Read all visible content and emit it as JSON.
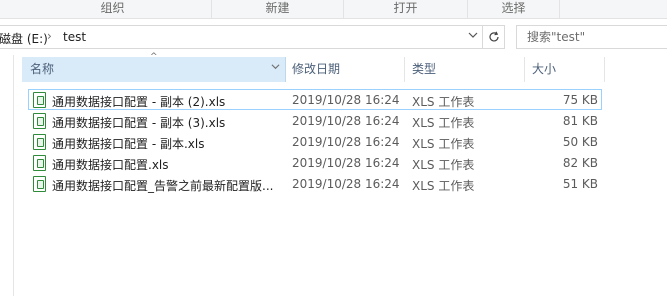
{
  "ribbon": {
    "groups": [
      "组织",
      "新建",
      "打开",
      "选择"
    ]
  },
  "address": {
    "drive": "磁盘 (E:)",
    "separator": "›",
    "folder": "test",
    "dropdown_icon": "chevron-down-icon",
    "refresh_icon": "refresh-icon"
  },
  "search": {
    "placeholder": "搜索\"test\""
  },
  "columns": {
    "name": "名称",
    "modified": "修改日期",
    "type": "类型",
    "size": "大小"
  },
  "files": [
    {
      "name": "通用数据接口配置 - 副本 (2).xls",
      "modified": "2019/10/28 16:24",
      "type": "XLS 工作表",
      "size": "75 KB"
    },
    {
      "name": "通用数据接口配置 - 副本 (3).xls",
      "modified": "2019/10/28 16:24",
      "type": "XLS 工作表",
      "size": "81 KB"
    },
    {
      "name": "通用数据接口配置 - 副本.xls",
      "modified": "2019/10/28 16:24",
      "type": "XLS 工作表",
      "size": "50 KB"
    },
    {
      "name": "通用数据接口配置.xls",
      "modified": "2019/10/28 16:24",
      "type": "XLS 工作表",
      "size": "82 KB"
    },
    {
      "name": "通用数据接口配置_告警之前最新配置版...",
      "modified": "2019/10/28 16:24",
      "type": "XLS 工作表",
      "size": "51 KB"
    }
  ],
  "colors": {
    "sorted_header_bg": "#d9ebf9",
    "focus_border": "#99d1ff",
    "excel_icon": "#2e8b3a"
  }
}
